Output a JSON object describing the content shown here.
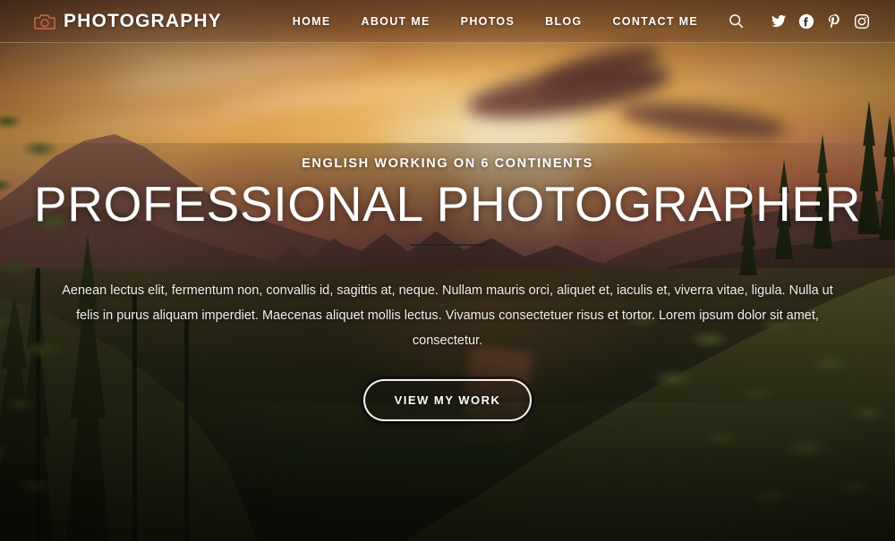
{
  "header": {
    "brand": {
      "icon": "camera-icon",
      "name": "PHOTOGRAPHY"
    },
    "nav": [
      {
        "label": "HOME",
        "name": "nav-link-home"
      },
      {
        "label": "ABOUT ME",
        "name": "nav-link-about-me"
      },
      {
        "label": "PHOTOS",
        "name": "nav-link-photos"
      },
      {
        "label": "BLOG",
        "name": "nav-link-blog"
      },
      {
        "label": "CONTACT ME",
        "name": "nav-link-contact-me"
      }
    ],
    "tools": [
      {
        "icon": "search-icon",
        "label": "Search"
      },
      {
        "icon": "twitter-icon",
        "label": "Twitter"
      },
      {
        "icon": "facebook-icon",
        "label": "Facebook"
      },
      {
        "icon": "pinterest-icon",
        "label": "Pinterest"
      },
      {
        "icon": "instagram-icon",
        "label": "Instagram"
      }
    ]
  },
  "hero": {
    "eyebrow": "ENGLISH WORKING ON 6 CONTINENTS",
    "title": "PROFESSIONAL PHOTOGRAPHER",
    "description": "Aenean lectus elit, fermentum non, convallis id, sagittis at, neque. Nullam mauris orci, aliquet et, iaculis et, viverra vitae, ligula. Nulla ut felis in purus aliquam imperdiet. Maecenas aliquet mollis lectus. Vivamus consectetuer risus et tortor. Lorem ipsum dolor sit amet, consectetur.",
    "cta_label": "VIEW MY WORK",
    "background": "sunset-mountain-valley-forest-photo"
  },
  "colors": {
    "brand_icon": "#c2603f",
    "text_on_hero": "#ffffff",
    "header_overlay": "rgba(52,32,18,0.30)",
    "sky_warm": "#e4a552",
    "sky_deep": "#8d5a3c",
    "forest_dark": "#222a15"
  }
}
